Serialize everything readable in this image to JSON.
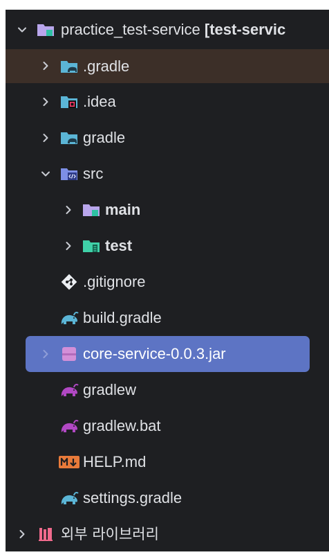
{
  "tree": {
    "root": {
      "label": "practice_test-service",
      "module": "[test-servic"
    },
    "items": [
      {
        "label": ".gradle",
        "icon": "folder-gradle-icon"
      },
      {
        "label": ".idea",
        "icon": "folder-idea-icon"
      },
      {
        "label": "gradle",
        "icon": "folder-gradle-icon"
      },
      {
        "label": "src",
        "icon": "folder-source-icon"
      },
      {
        "label": "main",
        "icon": "folder-module-icon"
      },
      {
        "label": "test",
        "icon": "folder-test-icon"
      },
      {
        "label": ".gitignore",
        "icon": "git-icon"
      },
      {
        "label": "build.gradle",
        "icon": "gradle-elephant-icon"
      },
      {
        "label": "core-service-0.0.3.jar",
        "icon": "jar-archive-icon"
      },
      {
        "label": "gradlew",
        "icon": "gradle-script-icon"
      },
      {
        "label": "gradlew.bat",
        "icon": "gradle-script-icon"
      },
      {
        "label": "HELP.md",
        "icon": "markdown-icon"
      },
      {
        "label": "settings.gradle",
        "icon": "gradle-elephant-icon"
      }
    ],
    "external_libraries": {
      "label": "외부 라이브러리",
      "icon": "library-icon"
    }
  },
  "colors": {
    "background": "#1e1f22",
    "highlight_row": "#3c2f28",
    "selection": "#5d74c4",
    "text": "#dfe1e5",
    "chevron": "#c9ccd3"
  }
}
